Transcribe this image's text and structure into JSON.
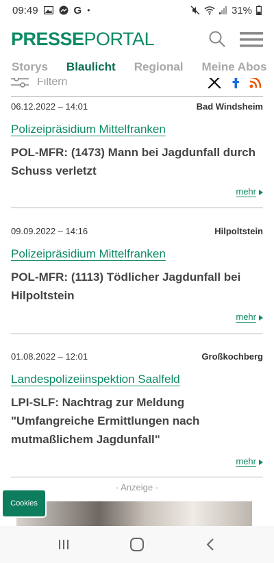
{
  "status_bar": {
    "time": "09:49",
    "battery": "31%",
    "icons": [
      "image-icon",
      "messenger-icon",
      "google-icon",
      "dot-icon",
      "mute-icon",
      "wifi-icon",
      "signal-icon",
      "battery-icon"
    ]
  },
  "header": {
    "logo_bold": "PRESSE",
    "logo_light": "PORTAL",
    "brand_color": "#0e8a66"
  },
  "tabs": [
    {
      "label": "Storys"
    },
    {
      "label": "Blaulicht"
    },
    {
      "label": "Regional"
    },
    {
      "label": "Meine Abos"
    }
  ],
  "filter": {
    "label": "Filtern",
    "social_icons": [
      "x-icon",
      "facebook-icon",
      "rss-icon"
    ]
  },
  "articles": [
    {
      "date": "06.12.2022 – 14:01",
      "place": "Bad Windsheim",
      "source": "Polizeipräsidium Mittelfranken",
      "title": "POL-MFR: (1473) Mann bei Jagdunfall durch Schuss verletzt",
      "more": "mehr"
    },
    {
      "date": "09.09.2022 – 14:16",
      "place": "Hilpoltstein",
      "source": "Polizeipräsidium Mittelfranken",
      "title": "POL-MFR: (1113) Tödlicher Jagdunfall bei Hilpoltstein",
      "more": "mehr"
    },
    {
      "date": "01.08.2022 – 12:01",
      "place": "Großkochberg",
      "source": "Landespolizeiinspektion Saalfeld",
      "title": "LPI-SLF: Nachtrag zur Meldung \"Umfangreiche Ermittlungen nach mutmaßlichem Jagdunfall\"",
      "more": "mehr"
    }
  ],
  "ad": {
    "label": "- Anzeige -"
  },
  "cookies": {
    "label": "Cookies"
  },
  "navbar": {
    "icons": [
      "recent-apps-icon",
      "home-icon",
      "back-icon"
    ]
  }
}
